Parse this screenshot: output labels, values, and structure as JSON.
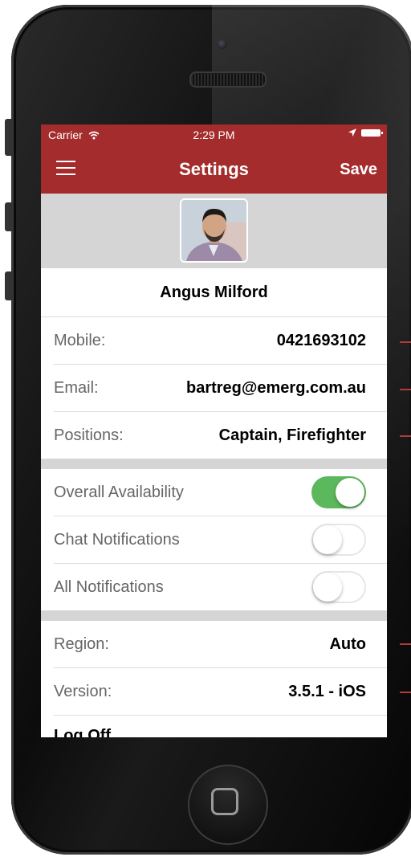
{
  "status_bar": {
    "carrier": "Carrier",
    "time": "2:29 PM"
  },
  "nav": {
    "title": "Settings",
    "save_label": "Save"
  },
  "profile": {
    "name": "Angus Milford"
  },
  "details": [
    {
      "label": "Mobile:",
      "value": "0421693102"
    },
    {
      "label": "Email:",
      "value": "bartreg@emerg.com.au"
    },
    {
      "label": "Positions:",
      "value": "Captain, Firefighter"
    }
  ],
  "toggles": [
    {
      "label": "Overall Availability",
      "state": "on"
    },
    {
      "label": "Chat Notifications",
      "state": "off"
    },
    {
      "label": "All Notifications",
      "state": "off"
    }
  ],
  "info": [
    {
      "label": "Region:",
      "value": "Auto"
    },
    {
      "label": "Version:",
      "value": "3.5.1 - iOS"
    }
  ],
  "logoff_label": "Log Off",
  "colors": {
    "brand": "#a42c2c",
    "toggle_on": "#5cb85c"
  }
}
